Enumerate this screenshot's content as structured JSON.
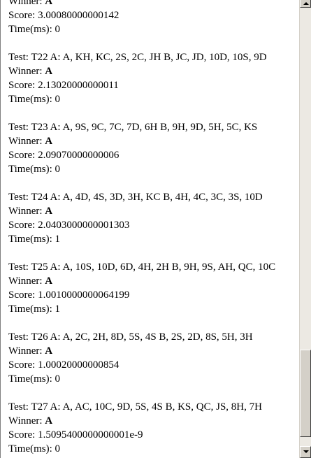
{
  "labels": {
    "test": "Test: ",
    "winner": "Winner: ",
    "score": "Score: ",
    "time": "Time(ms): "
  },
  "partial": {
    "winner": "A",
    "score": "3.00080000000142",
    "time": "0"
  },
  "tests": [
    {
      "id": "T22",
      "hands": "A: A, KH, KC, 2S, 2C, JH B, JC, JD, 10D, 10S, 9D",
      "winner": "A",
      "score": "2.13020000000011",
      "time": "0"
    },
    {
      "id": "T23",
      "hands": "A: A, 9S, 9C, 7C, 7D, 6H B, 9H, 9D, 5H, 5C, KS",
      "winner": "A",
      "score": "2.09070000000006",
      "time": "0"
    },
    {
      "id": "T24",
      "hands": "A: A, 4D, 4S, 3D, 3H, KC B, 4H, 4C, 3C, 3S, 10D",
      "winner": "A",
      "score": "2.0403000000001303",
      "time": "1"
    },
    {
      "id": "T25",
      "hands": "A: A, 10S, 10D, 6D, 4H, 2H B, 9H, 9S, AH, QC, 10C",
      "winner": "A",
      "score": "1.0010000000064199",
      "time": "1"
    },
    {
      "id": "T26",
      "hands": "A: A, 2C, 2H, 8D, 5S, 4S B, 2S, 2D, 8S, 5H, 3H",
      "winner": "A",
      "score": "1.00020000000854",
      "time": "0"
    },
    {
      "id": "T27",
      "hands": "A: A, AC, 10C, 9D, 5S, 4S B, KS, QC, JS, 8H, 7H",
      "winner": "A",
      "score": "1.5095400000000001e-9",
      "time": "0"
    }
  ]
}
